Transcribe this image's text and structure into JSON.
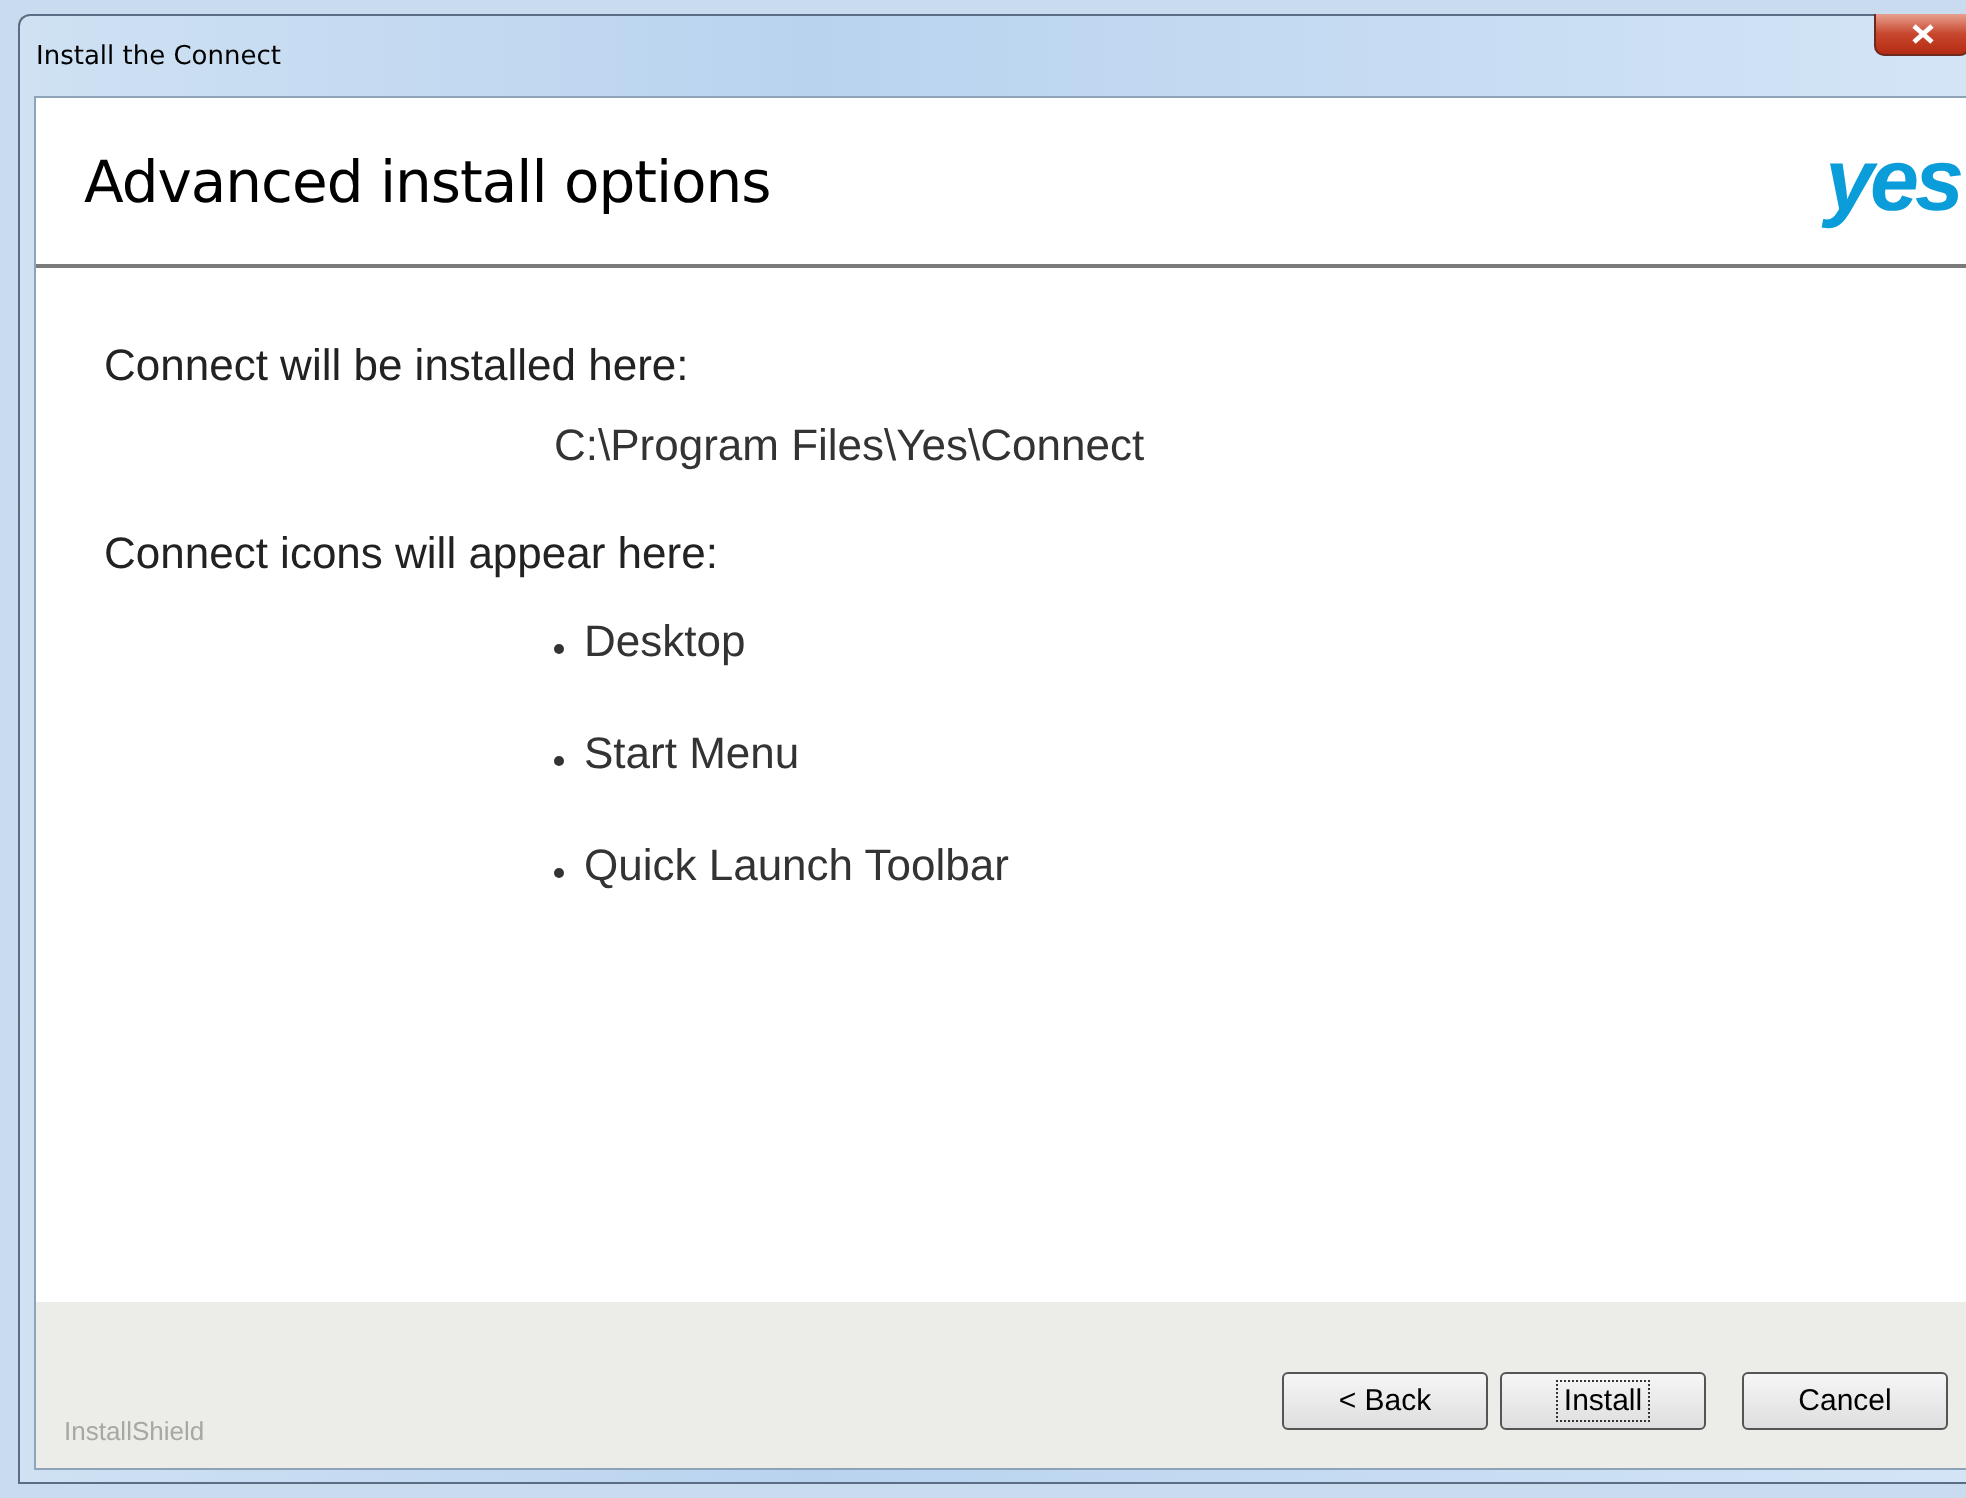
{
  "window": {
    "title": "Install the Connect"
  },
  "header": {
    "title": "Advanced install options",
    "logo": "yes"
  },
  "sections": [
    {
      "label": "Connect will be installed here:",
      "kind": "path",
      "items": [
        "C:\\Program Files\\Yes\\Connect"
      ]
    },
    {
      "label": "Connect icons will appear here:",
      "kind": "bullets",
      "items": [
        "Desktop",
        "Start Menu",
        "Quick Launch Toolbar"
      ]
    }
  ],
  "footer": {
    "brand": "InstallShield",
    "buttons": [
      {
        "label": "< Back",
        "focused": false
      },
      {
        "label": "Install",
        "focused": true
      },
      {
        "label": "Cancel",
        "focused": false
      }
    ]
  }
}
